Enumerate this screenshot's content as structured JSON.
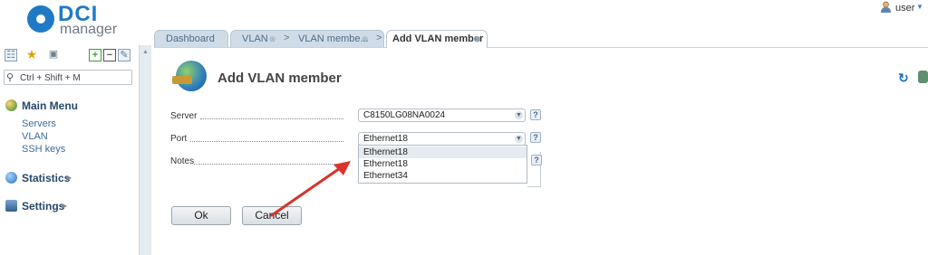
{
  "header": {
    "logo_text": "DCI",
    "logo_sub": "manager",
    "user": "user"
  },
  "sidebar": {
    "search_placeholder": "Ctrl + Shift + M",
    "main_menu": "Main Menu",
    "items": [
      "Servers",
      "VLAN",
      "SSH keys"
    ],
    "statistics": "Statistics",
    "settings": "Settings"
  },
  "tabs": [
    {
      "label": "Dashboard"
    },
    {
      "label": "VLAN"
    },
    {
      "label": "VLAN membe..."
    },
    {
      "label": "Add VLAN member"
    }
  ],
  "form": {
    "title": "Add VLAN member",
    "server_label": "Server",
    "server_value": "C8150LG08NA0024",
    "port_label": "Port",
    "port_value": "Ethernet18",
    "notes_label": "Notes",
    "port_options": [
      "Ethernet18",
      "Ethernet18",
      "Ethernet34"
    ],
    "ok_label": "Ok",
    "cancel_label": "Cancel"
  },
  "icons": {
    "help_glyph": "?",
    "close_glyph": "⊗",
    "breadcrumb_glyph": ">"
  },
  "colors": {
    "accent": "#1f7ac6",
    "annotation_arrow": "#d9342b"
  }
}
